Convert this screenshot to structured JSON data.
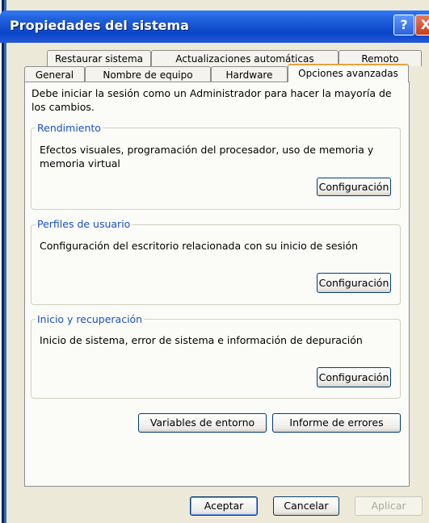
{
  "window": {
    "title": "Propiedades del sistema",
    "help_label": "?",
    "close_label": "X"
  },
  "tabs": {
    "row1": [
      "Restaurar sistema",
      "Actualizaciones automáticas",
      "Remoto"
    ],
    "row2": [
      "General",
      "Nombre de equipo",
      "Hardware",
      "Opciones avanzadas"
    ],
    "active": "Opciones avanzadas"
  },
  "panel": {
    "intro": "Debe iniciar la sesión como un Administrador para hacer la mayoría de los cambios.",
    "performance": {
      "label": "Rendimiento",
      "text": "Efectos visuales, programación del procesador, uso de memoria y memoria virtual",
      "button": "Configuración"
    },
    "profiles": {
      "label": "Perfiles de usuario",
      "text": "Configuración del escritorio relacionada con su inicio de sesión",
      "button": "Configuración"
    },
    "startup": {
      "label": "Inicio y recuperación",
      "text": "Inicio de sistema, error de sistema e información de depuración",
      "button": "Configuración"
    },
    "env_button": "Variables de entorno",
    "errors_button": "Informe de errores"
  },
  "footer": {
    "ok": "Aceptar",
    "cancel": "Cancelar",
    "apply": "Aplicar"
  },
  "colors": {
    "titlebar": "#0a46c8",
    "group_label": "#1a4fc7",
    "active_tab_highlight": "#e6a23b",
    "dialog_background": "#ece9d8"
  }
}
